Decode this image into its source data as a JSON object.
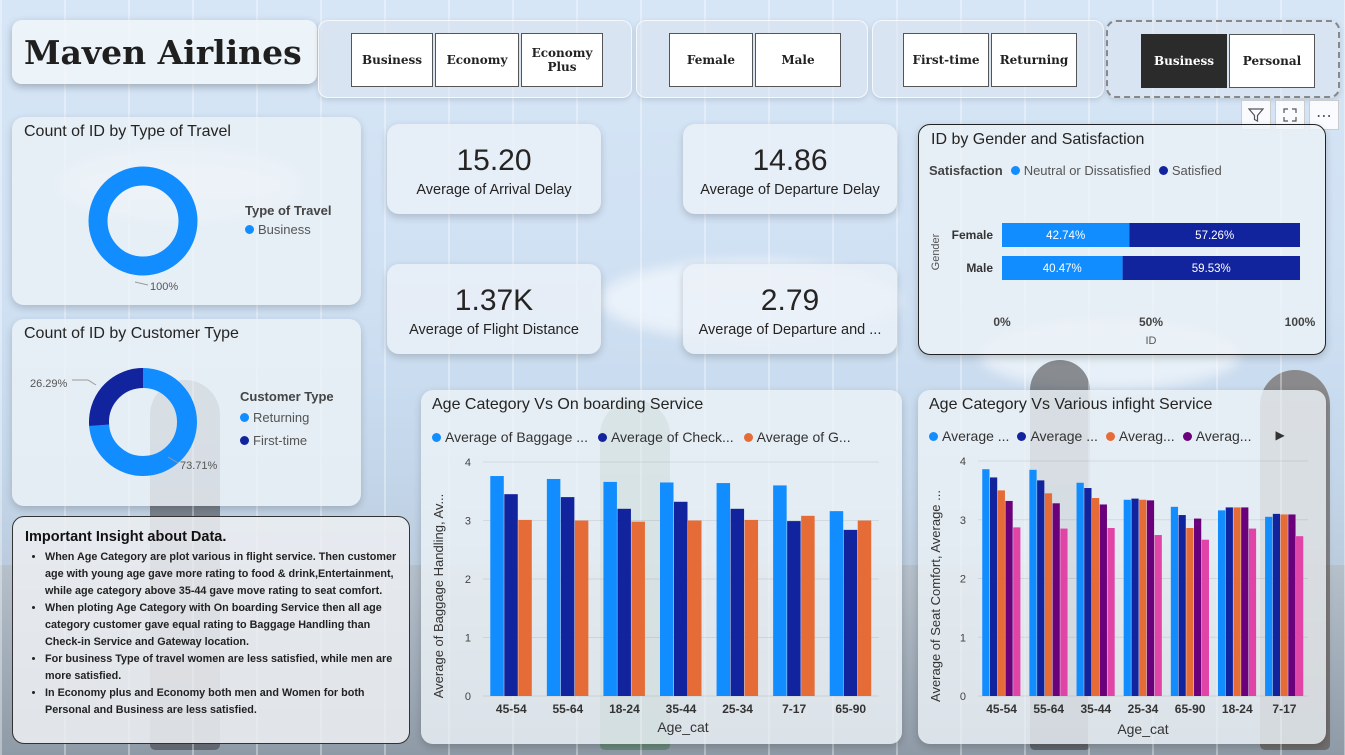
{
  "brand": {
    "title": "Maven Airlines"
  },
  "slicers": {
    "class": [
      "Business",
      "Economy",
      "Economy Plus"
    ],
    "gender": [
      "Female",
      "Male"
    ],
    "customer": [
      "First-time",
      "Returning"
    ],
    "travel": [
      "Business",
      "Personal"
    ],
    "travel_selected": "Business"
  },
  "type_of_travel": {
    "title": "Count of ID by Type of Travel",
    "legend_title": "Type of Travel",
    "legend": [
      "Business"
    ],
    "label": "100%"
  },
  "customer_type": {
    "title": "Count of ID by Customer Type",
    "legend_title": "Customer Type",
    "legend": [
      "Returning",
      "First-time"
    ],
    "labels": [
      "26.29%",
      "73.71%"
    ]
  },
  "kpis": [
    {
      "value": "15.20",
      "label": "Average of Arrival Delay"
    },
    {
      "value": "14.86",
      "label": "Average of Departure Delay"
    },
    {
      "value": "1.37K",
      "label": "Average of Flight Distance"
    },
    {
      "value": "2.79",
      "label": "Average of Departure and ..."
    }
  ],
  "gender_satisfaction": {
    "title": "ID by Gender and Satisfaction",
    "legend_title": "Satisfaction",
    "legend": [
      "Neutral or Dissatisfied",
      "Satisfied"
    ],
    "y_title": "Gender",
    "x_title": "ID",
    "x_ticks": [
      "0%",
      "50%",
      "100%"
    ]
  },
  "onboarding": {
    "title": "Age Category Vs On boarding Service",
    "legend": [
      "Average of Baggage ...",
      "Average of Check...",
      "Average of G..."
    ],
    "y_title": "Average of Baggage Handling, Av...",
    "x_title": "Age_cat",
    "y_ticks": [
      "0",
      "1",
      "2",
      "3",
      "4"
    ]
  },
  "inflight": {
    "title": "Age Category Vs Various infight Service",
    "legend": [
      "Average ...",
      "Average ...",
      "Averag...",
      "Averag..."
    ],
    "legend_more": "▶",
    "y_title": "Average of Seat Comfort, Average ...",
    "x_title": "Age_cat",
    "y_ticks": [
      "0",
      "1",
      "2",
      "3",
      "4"
    ]
  },
  "insight": {
    "heading": "Important Insight about Data.",
    "points": [
      "When Age Category are plot various in flight service. Then customer age with young age gave more rating to food & drink,Entertainment, while age category above 35-44 gave move rating to seat comfort.",
      "When ploting Age Category with On boarding Service then all age category customer gave equal rating to Baggage Handling than Check-in Service and Gateway location.",
      "For business Type of travel women are less satisfied, while men are more satisfied.",
      "In Economy plus and Economy both men and Women for both Personal and Business are less satisfied."
    ]
  },
  "colors": {
    "blue": "#118dff",
    "navy": "#12239e",
    "orange": "#e66c37",
    "purple": "#6b007b",
    "magenta": "#e044a7"
  },
  "chart_data": [
    {
      "type": "pie",
      "title": "Count of ID by Type of Travel",
      "categories": [
        "Business"
      ],
      "values": [
        100
      ]
    },
    {
      "type": "pie",
      "title": "Count of ID by Customer Type",
      "categories": [
        "Returning",
        "First-time"
      ],
      "values": [
        73.71,
        26.29
      ]
    },
    {
      "type": "bar",
      "orientation": "horizontal-stacked-100",
      "title": "ID by Gender and Satisfaction",
      "categories": [
        "Female",
        "Male"
      ],
      "series": [
        {
          "name": "Neutral or Dissatisfied",
          "values": [
            42.74,
            40.47
          ],
          "labels": [
            "42.74%",
            "40.47%"
          ]
        },
        {
          "name": "Satisfied",
          "values": [
            57.26,
            59.53
          ],
          "labels": [
            "57.26%",
            "59.53%"
          ]
        }
      ],
      "xlabel": "ID",
      "ylabel": "Gender",
      "xlim": [
        0,
        100
      ]
    },
    {
      "type": "bar",
      "title": "Age Category Vs On boarding Service",
      "categories": [
        "45-54",
        "55-64",
        "18-24",
        "35-44",
        "25-34",
        "7-17",
        "65-90"
      ],
      "series": [
        {
          "name": "Average of Baggage ...",
          "values": [
            3.76,
            3.71,
            3.66,
            3.65,
            3.64,
            3.6,
            3.16
          ]
        },
        {
          "name": "Average of Check...",
          "values": [
            3.45,
            3.4,
            3.2,
            3.32,
            3.2,
            2.99,
            2.84
          ]
        },
        {
          "name": "Average of G...",
          "values": [
            3.01,
            3.0,
            2.98,
            3.0,
            3.01,
            3.08,
            3.0
          ]
        }
      ],
      "xlabel": "Age_cat",
      "ylabel": "Average of Baggage Handling, Av...",
      "ylim": [
        0,
        4
      ]
    },
    {
      "type": "bar",
      "title": "Age Category Vs Various infight Service",
      "categories": [
        "45-54",
        "55-64",
        "35-44",
        "25-34",
        "65-90",
        "18-24",
        "7-17"
      ],
      "series": [
        {
          "name": "Average ...",
          "values": [
            3.86,
            3.85,
            3.63,
            3.34,
            3.22,
            3.16,
            3.05
          ]
        },
        {
          "name": "Average ...",
          "values": [
            3.72,
            3.67,
            3.54,
            3.36,
            3.08,
            3.21,
            3.1
          ]
        },
        {
          "name": "Averag...",
          "values": [
            3.5,
            3.45,
            3.37,
            3.34,
            2.86,
            3.21,
            3.09
          ]
        },
        {
          "name": "Averag...",
          "values": [
            3.32,
            3.28,
            3.26,
            3.33,
            3.02,
            3.21,
            3.09
          ]
        },
        {
          "name": "",
          "values": [
            2.87,
            2.85,
            2.86,
            2.74,
            2.66,
            2.85,
            2.72
          ]
        }
      ],
      "xlabel": "Age_cat",
      "ylabel": "Average of Seat Comfort, Average ...",
      "ylim": [
        0,
        4
      ]
    }
  ]
}
